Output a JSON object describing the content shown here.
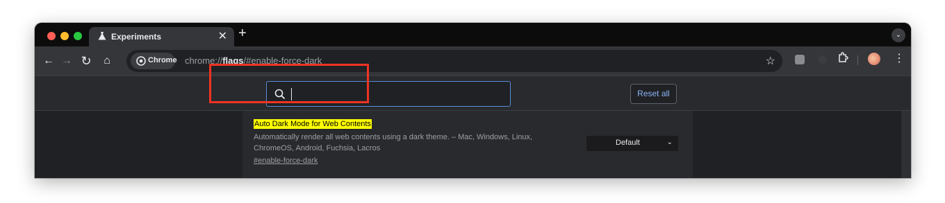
{
  "browser": {
    "tab": {
      "title": "Experiments",
      "close_glyph": "✕"
    },
    "new_tab_glyph": "+",
    "tab_search_glyph": "⌄",
    "nav": {
      "back": "←",
      "forward": "→",
      "reload": "↻",
      "home": "⌂"
    },
    "omnibox": {
      "chip_label": "Chrome",
      "url_prefix": "chrome://",
      "url_host": "flags",
      "url_suffix": "/#enable-force-dark"
    },
    "star_glyph": "☆",
    "menu_glyph": "⋮"
  },
  "flags_page": {
    "search": {
      "value": ""
    },
    "reset_label": "Reset all",
    "flag": {
      "name": "Auto Dark Mode for Web Contents",
      "description": "Automatically render all web contents using a dark theme. – Mac, Windows, Linux, ChromeOS, Android, Fuchsia, Lacros",
      "link": "#enable-force-dark",
      "selected_option": "Default",
      "chevron": "⌄"
    }
  },
  "colors": {
    "annotation": "#ef3324",
    "highlight": "#ffff00",
    "accent": "#8ab4f8"
  }
}
